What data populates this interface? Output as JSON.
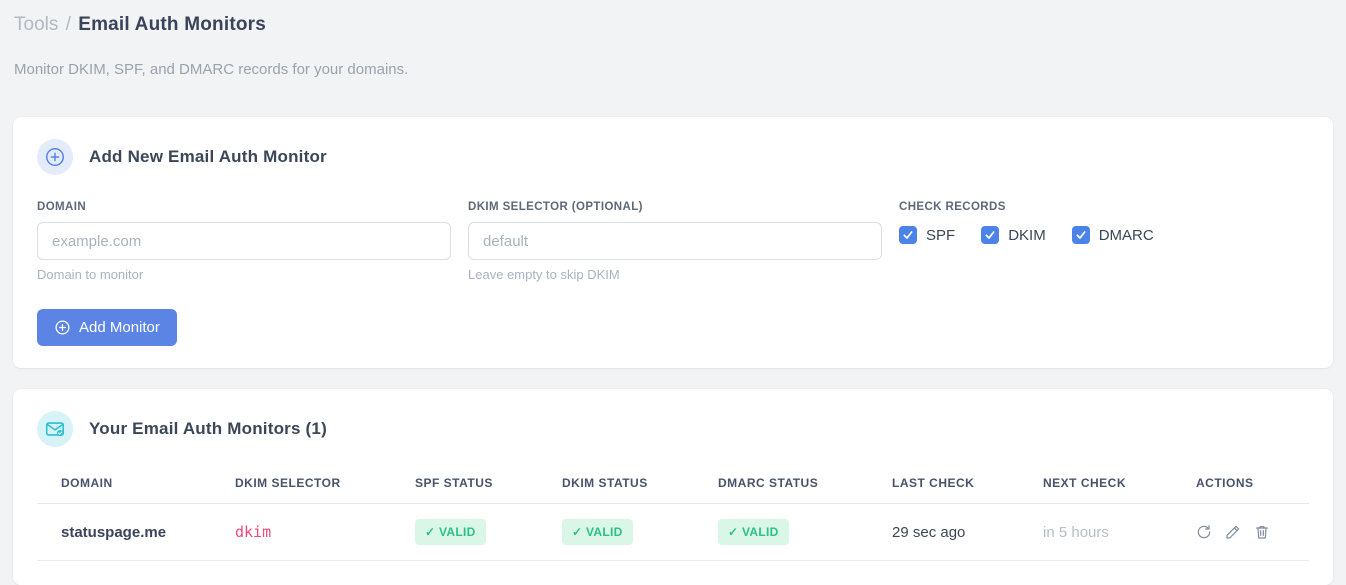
{
  "page": {
    "breadcrumb": {
      "section": "Tools",
      "separator": "/",
      "current": "Email Auth Monitors"
    },
    "subtitle": "Monitor DKIM, SPF, and DMARC records for your domains."
  },
  "colors": {
    "accent_blue": "#5b84e4",
    "checkbox_blue": "#4b83e8",
    "teal_icon": "#2ac0d0",
    "badge_green_text": "#2cc184",
    "badge_green_bg": "#d9f6e7",
    "selector_pink": "#ee4a7b",
    "page_background": "#f2f3f5"
  },
  "add_monitor_card": {
    "header_icon": "plus-circle-icon",
    "title": "Add New Email Auth Monitor",
    "fields": {
      "domain": {
        "label": "DOMAIN",
        "placeholder": "example.com",
        "value": "",
        "helper": "Domain to monitor"
      },
      "dkim_selector": {
        "label": "DKIM SELECTOR (OPTIONAL)",
        "placeholder": "default",
        "value": "",
        "helper": "Leave empty to skip DKIM"
      }
    },
    "check_records": {
      "label": "CHECK RECORDS",
      "options": [
        {
          "label": "SPF",
          "checked": true
        },
        {
          "label": "DKIM",
          "checked": true
        },
        {
          "label": "DMARC",
          "checked": true
        }
      ]
    },
    "submit_label": "Add Monitor",
    "submit_icon": "plus-circle-icon"
  },
  "monitors_card": {
    "header_icon": "mail-check-icon",
    "title": "Your Email Auth Monitors (1)",
    "table": {
      "columns": [
        "DOMAIN",
        "DKIM SELECTOR",
        "SPF STATUS",
        "DKIM STATUS",
        "DMARC STATUS",
        "LAST CHECK",
        "NEXT CHECK",
        "ACTIONS"
      ],
      "rows": [
        {
          "domain": "statuspage.me",
          "dkim_selector": "dkim",
          "spf_status": "✓ VALID",
          "dkim_status": "✓ VALID",
          "dmarc_status": "✓ VALID",
          "last_check": "29 sec ago",
          "next_check": "in 5 hours",
          "actions": [
            "refresh-icon",
            "edit-pencil-icon",
            "trash-icon"
          ]
        }
      ]
    }
  }
}
